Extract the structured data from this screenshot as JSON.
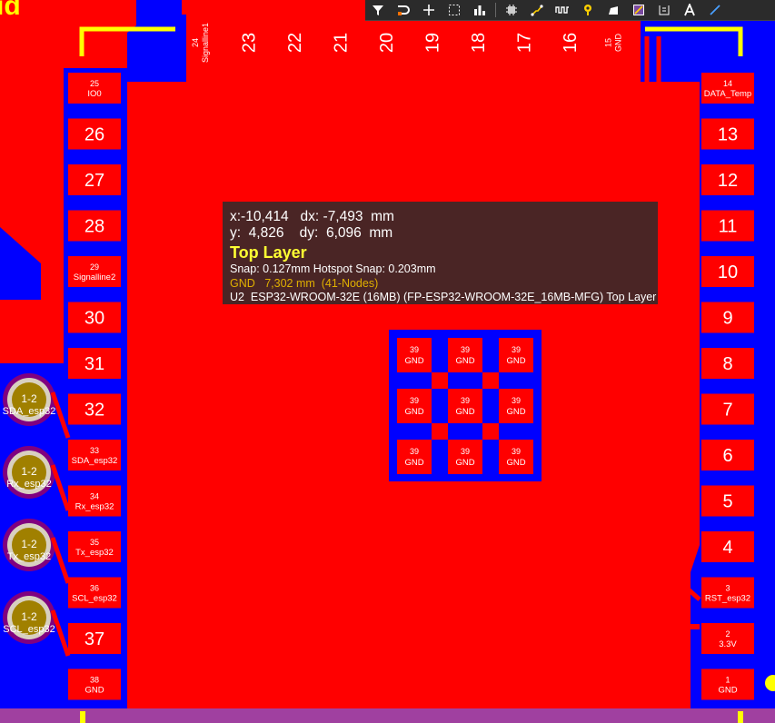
{
  "toolbar": {
    "tools": [
      {
        "icon": "filter-icon"
      },
      {
        "icon": "route-icon"
      },
      {
        "icon": "add-icon"
      },
      {
        "icon": "select-rect-icon"
      },
      {
        "icon": "chart-icon"
      },
      {
        "icon": "component-icon"
      },
      {
        "icon": "track-icon"
      },
      {
        "icon": "length-tune-icon"
      },
      {
        "icon": "via-icon"
      },
      {
        "icon": "fill-icon"
      },
      {
        "icon": "region-icon"
      },
      {
        "icon": "string-icon"
      },
      {
        "icon": "text-icon"
      },
      {
        "icon": "line-icon"
      }
    ]
  },
  "tooltip": {
    "coords_line1": "x:-10,414   dx: -7,493  mm",
    "coords_line2": "y:  4,826    dy:  6,096  mm",
    "layer": "Top Layer",
    "snap": "Snap: 0.127mm Hotspot Snap: 0.203mm",
    "net_info": "GND   7,302 mm  (41-Nodes)",
    "component": "U2  ESP32-WROOM-32E (16MB) (FP-ESP32-WROOM-32E_16MB-MFG) Top Layer"
  },
  "pads": {
    "left": [
      {
        "num": "25",
        "net": "IO0"
      },
      {
        "num": "26",
        "net": ""
      },
      {
        "num": "27",
        "net": ""
      },
      {
        "num": "28",
        "net": ""
      },
      {
        "num": "29",
        "net": "Signalline2"
      },
      {
        "num": "30",
        "net": ""
      },
      {
        "num": "31",
        "net": ""
      },
      {
        "num": "32",
        "net": ""
      },
      {
        "num": "33",
        "net": "SDA_esp32"
      },
      {
        "num": "34",
        "net": "Rx_esp32"
      },
      {
        "num": "35",
        "net": "Tx_esp32"
      },
      {
        "num": "36",
        "net": "SCL_esp32"
      },
      {
        "num": "37",
        "net": ""
      },
      {
        "num": "38",
        "net": "GND"
      }
    ],
    "right": [
      {
        "num": "14",
        "net": "DATA_Temp"
      },
      {
        "num": "13",
        "net": ""
      },
      {
        "num": "12",
        "net": ""
      },
      {
        "num": "11",
        "net": ""
      },
      {
        "num": "10",
        "net": ""
      },
      {
        "num": "9",
        "net": ""
      },
      {
        "num": "8",
        "net": ""
      },
      {
        "num": "7",
        "net": ""
      },
      {
        "num": "6",
        "net": ""
      },
      {
        "num": "5",
        "net": ""
      },
      {
        "num": "4",
        "net": ""
      },
      {
        "num": "3",
        "net": "RST_esp32"
      },
      {
        "num": "2",
        "net": "3.3V"
      },
      {
        "num": "1",
        "net": "GND"
      }
    ],
    "top": [
      {
        "num": "24",
        "net": "Signalline1"
      },
      {
        "num": "23",
        "net": ""
      },
      {
        "num": "22",
        "net": ""
      },
      {
        "num": "21",
        "net": ""
      },
      {
        "num": "20",
        "net": ""
      },
      {
        "num": "19",
        "net": ""
      },
      {
        "num": "18",
        "net": ""
      },
      {
        "num": "17",
        "net": ""
      },
      {
        "num": "16",
        "net": ""
      },
      {
        "num": "15",
        "net": "GND"
      }
    ],
    "center_num": "39",
    "center_net": "GND"
  },
  "connectors": [
    {
      "num": "1-2",
      "net": "SDA_esp32"
    },
    {
      "num": "1-2",
      "net": "Rx_esp32"
    },
    {
      "num": "1-2",
      "net": "Tx_esp32"
    },
    {
      "num": "1-2",
      "net": "SCL_esp32"
    }
  ],
  "corner_logo": "ıd",
  "colors": {
    "top_copper": "#ff0000",
    "bottom_copper": "#0000ff",
    "overlay": "#ffff00",
    "pad_text": "#ffffff",
    "via_ring": "#800080",
    "via_hole": "#a08000",
    "toolbar_bg": "#2b2b2b"
  }
}
